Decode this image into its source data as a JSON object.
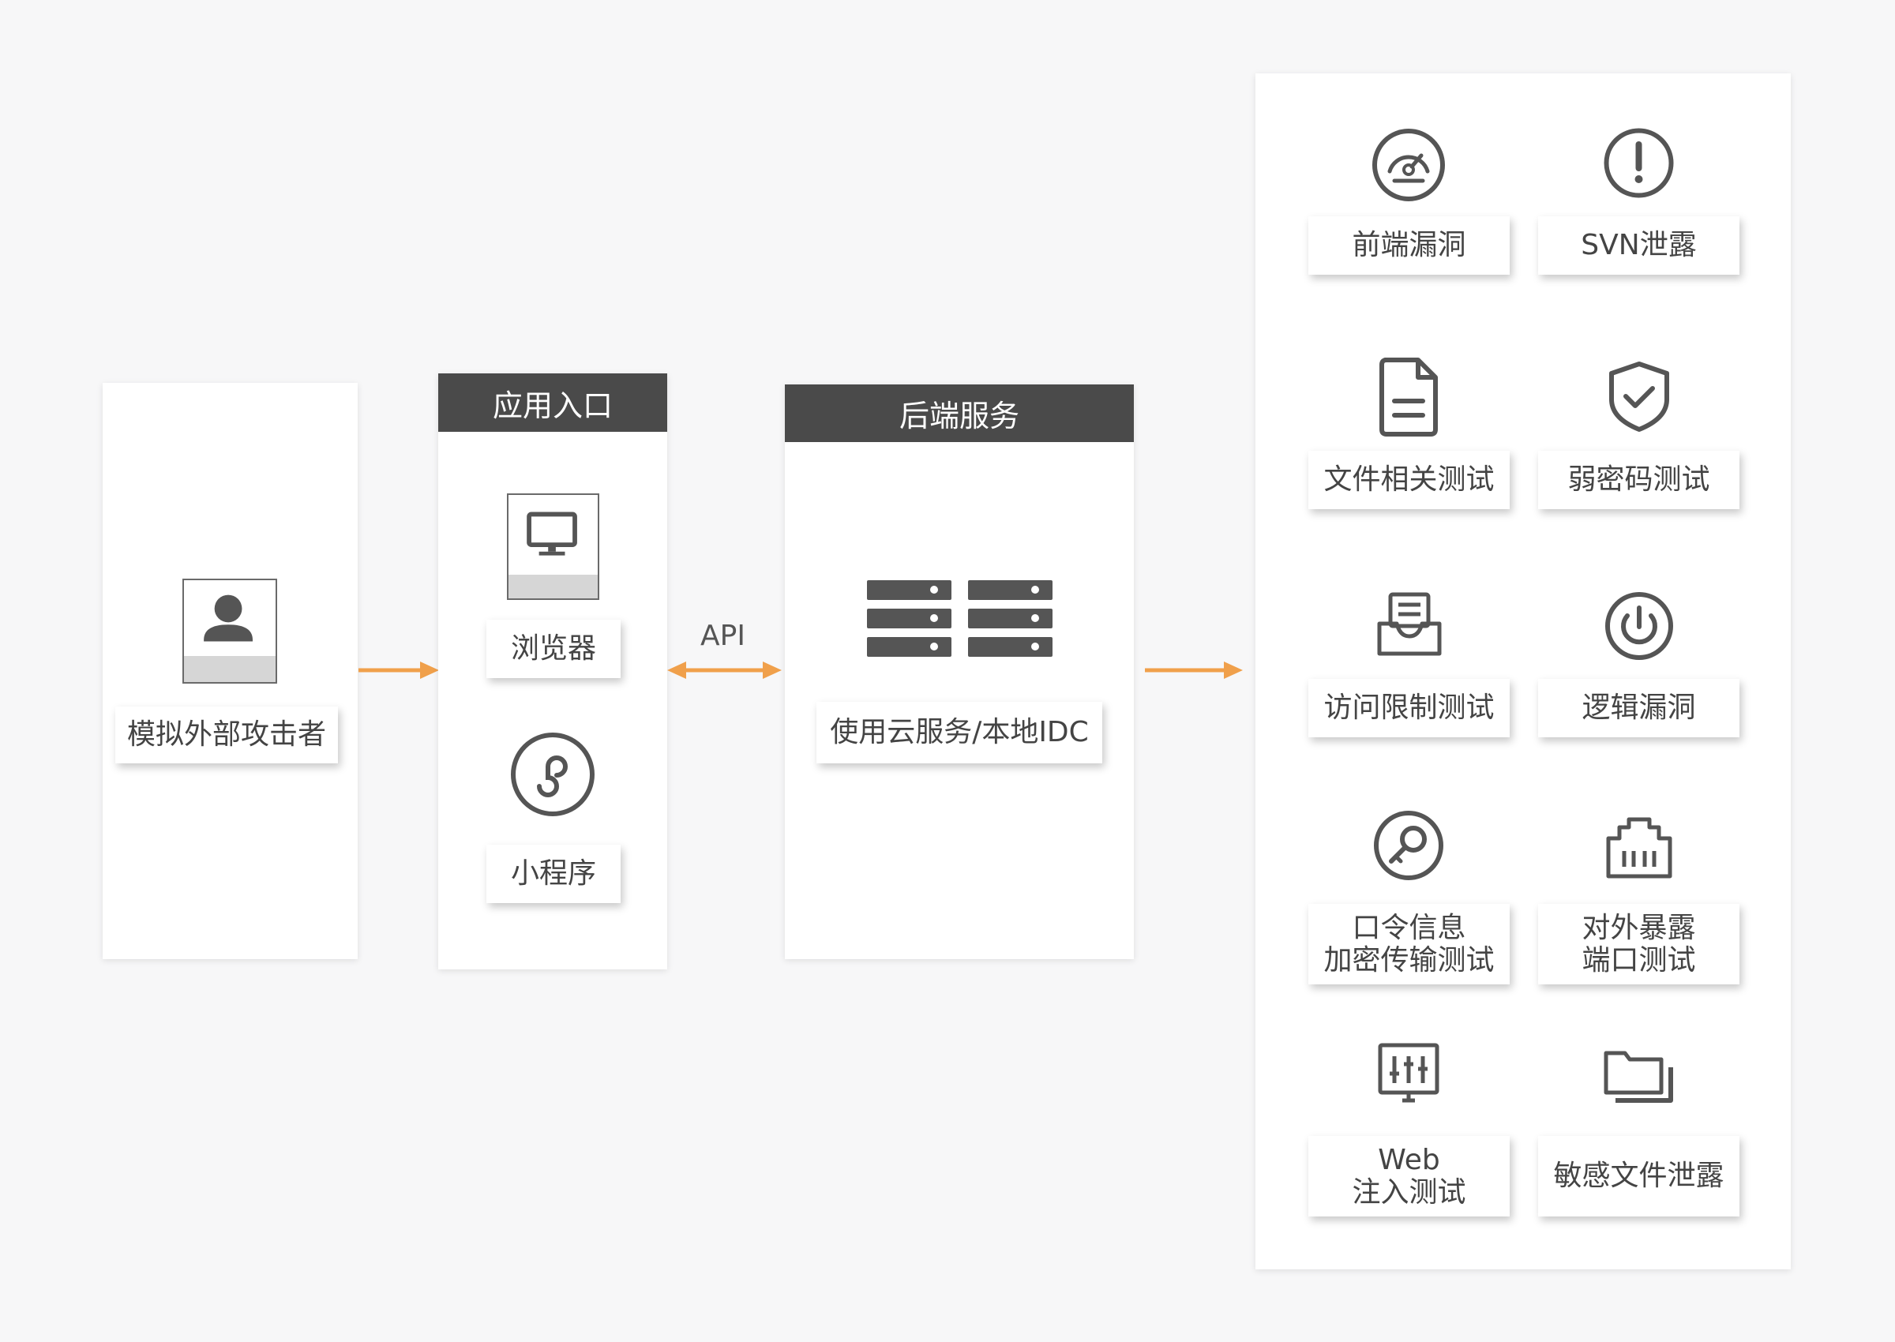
{
  "attacker": {
    "label": "模拟外部攻击者",
    "icon": "person-icon"
  },
  "entry": {
    "header": "应用入口",
    "browser": {
      "label": "浏览器",
      "icon": "monitor-icon"
    },
    "miniprogram": {
      "label": "小程序",
      "icon": "mini-program-icon"
    }
  },
  "connector": {
    "label": "API"
  },
  "backend": {
    "header": "后端服务",
    "label": "使用云服务/本地IDC",
    "icon": "server-rack-icon"
  },
  "tests": [
    {
      "label_lines": [
        "前端漏洞"
      ],
      "icon": "speedometer-icon"
    },
    {
      "label_lines": [
        "SVN泄露"
      ],
      "icon": "exclamation-circle-icon"
    },
    {
      "label_lines": [
        "文件相关测试"
      ],
      "icon": "document-icon"
    },
    {
      "label_lines": [
        "弱密码测试"
      ],
      "icon": "shield-check-icon"
    },
    {
      "label_lines": [
        "访问限制测试"
      ],
      "icon": "inbox-tray-icon"
    },
    {
      "label_lines": [
        "逻辑漏洞"
      ],
      "icon": "power-circle-icon"
    },
    {
      "label_lines": [
        "口令信息",
        "加密传输测试"
      ],
      "icon": "key-search-icon"
    },
    {
      "label_lines": [
        "对外暴露",
        "端口测试"
      ],
      "icon": "network-port-icon"
    },
    {
      "label_lines": [
        "Web",
        "注入测试"
      ],
      "icon": "equalizer-monitor-icon"
    },
    {
      "label_lines": [
        "敏感文件泄露"
      ],
      "icon": "folders-icon"
    }
  ],
  "colors": {
    "arrow": "#f0a04b",
    "header": "#4a4a4a",
    "icon": "#555555"
  }
}
